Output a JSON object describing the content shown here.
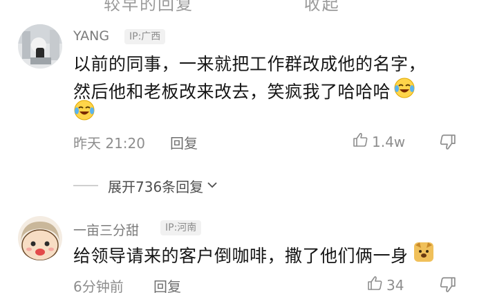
{
  "top_partial": {
    "left": "较早的回复",
    "right": "收起"
  },
  "comments": [
    {
      "username": "YANG",
      "ip": "IP:广西",
      "text_line1": "以前的同事，一来就把工作群改成他的名字，",
      "text_line2": "然后他和老板改来改去，笑疯我了哈哈哈",
      "time": "昨天 21:20",
      "reply": "回复",
      "likes": "1.4w"
    },
    {
      "username": "一亩三分甜",
      "ip": "IP:河南",
      "text": "给领导请来的客户倒咖啡，撒了他们俩一身",
      "time": "6分钟前",
      "reply": "回复",
      "likes": "34"
    }
  ],
  "expand": {
    "label": "展开736条回复"
  },
  "icons": {
    "avatar1": "avatar-photo-icon",
    "avatar2": "cartoon-avatar-icon",
    "emoji_laugh": "laugh-cry-emoji-icon",
    "emoji_dog": "dog-emoji-icon",
    "like": "thumb-up-icon",
    "dislike": "thumb-down-icon",
    "chevron": "chevron-down-icon"
  }
}
